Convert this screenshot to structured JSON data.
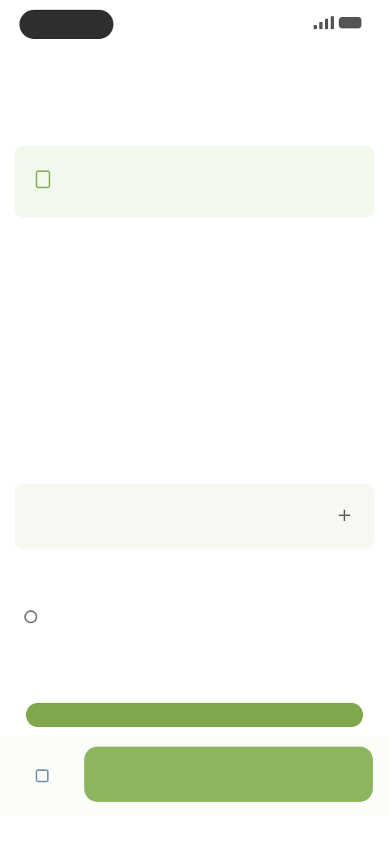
{
  "status_bar": {
    "time": "",
    "icons": [
      "signal-icon",
      "battery-icon"
    ]
  },
  "header": {
    "title": ""
  },
  "sections": {
    "field": {
      "label": "",
      "value": "",
      "placeholder": ""
    },
    "description": {
      "label": "",
      "text": "",
      "more": ""
    },
    "details": {
      "label": "",
      "text": "",
      "more": ""
    },
    "card": {
      "text": "",
      "button_label": ""
    },
    "options": {
      "label": "",
      "item": ""
    },
    "progress": {
      "label": "",
      "value": 1.0
    }
  },
  "footer": {
    "primary_label": ""
  },
  "colors": {
    "accent": "#8cb55e",
    "accent_dark": "#7fa84c",
    "link": "#9b7fe0",
    "field_bg": "#f3f8ec"
  }
}
